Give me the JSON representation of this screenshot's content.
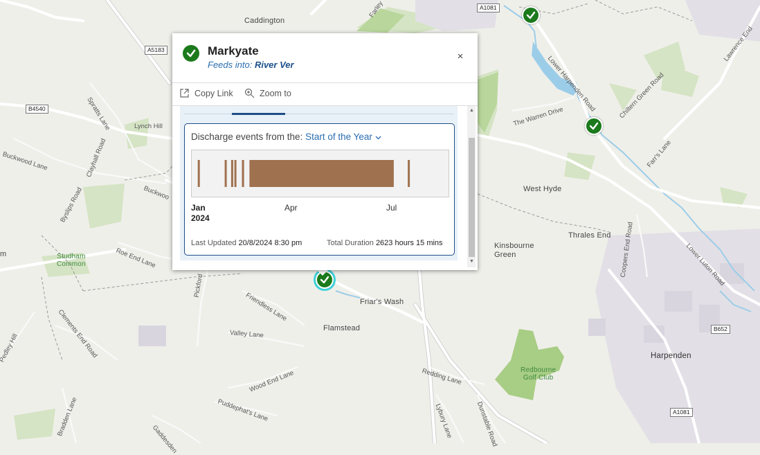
{
  "map": {
    "places": [
      {
        "id": "caddington",
        "label": "Caddington"
      },
      {
        "id": "west-hyde",
        "label": "West Hyde"
      },
      {
        "id": "thrales-end",
        "label": "Thrales End"
      },
      {
        "id": "kinsbourne-green",
        "label": "Kinsbourne\nGreen"
      },
      {
        "id": "friars-wash",
        "label": "Friar's Wash"
      },
      {
        "id": "flamstead",
        "label": "Flamstead"
      },
      {
        "id": "harpenden",
        "label": "Harpenden"
      },
      {
        "id": "studham-common",
        "label": "Studham\nCommon"
      },
      {
        "id": "redbourne-golf",
        "label": "Redbourne\nGolf Club"
      },
      {
        "id": "m-edge",
        "label": "m"
      }
    ],
    "roads": [
      {
        "id": "spratts-lane",
        "label": "Spratts Lane"
      },
      {
        "id": "lynch-hill",
        "label": "Lynch Hill"
      },
      {
        "id": "buckwood-lane",
        "label": "Buckwood Lane"
      },
      {
        "id": "clayhall-road",
        "label": "Clayhall Road"
      },
      {
        "id": "buckwood",
        "label": "Buckwoo"
      },
      {
        "id": "byslips-road",
        "label": "Byslips Road"
      },
      {
        "id": "roe-end-lane",
        "label": "Roe End Lane"
      },
      {
        "id": "pickford",
        "label": "Pickford"
      },
      {
        "id": "friendless-lane",
        "label": "Friendless Lane"
      },
      {
        "id": "valley-lane",
        "label": "Valley Lane"
      },
      {
        "id": "clements-end-road",
        "label": "Clements End Road"
      },
      {
        "id": "pedley-hill",
        "label": "Pedley Hill"
      },
      {
        "id": "wood-end-lane",
        "label": "Wood End Lane"
      },
      {
        "id": "puddephats-lane",
        "label": "Puddephat's Lane"
      },
      {
        "id": "bradden-lane",
        "label": "Bradden Lane"
      },
      {
        "id": "gaddesden",
        "label": "Gaddesden"
      },
      {
        "id": "redding-lane",
        "label": "Redding Lane"
      },
      {
        "id": "lybury-lane",
        "label": "Lybury Lane"
      },
      {
        "id": "dunstable-road",
        "label": "Dunstable Road"
      },
      {
        "id": "lower-harpenden-road",
        "label": "Lower Harpenden Road"
      },
      {
        "id": "the-warren-drive",
        "label": "The Warren Drive"
      },
      {
        "id": "chiltern-green-road",
        "label": "Chiltern Green Road"
      },
      {
        "id": "farrs-lane",
        "label": "Farr's Lane"
      },
      {
        "id": "lawrence-end",
        "label": "Lawrence End"
      },
      {
        "id": "coopers-end-road",
        "label": "Coopers End Road"
      },
      {
        "id": "lower-luton-road",
        "label": "Lower Luton Road"
      },
      {
        "id": "farley",
        "label": "Farley"
      }
    ],
    "shields": [
      {
        "id": "a5183",
        "label": "A5183"
      },
      {
        "id": "b4540",
        "label": "B4540"
      },
      {
        "id": "a1081-top",
        "label": "A1081"
      },
      {
        "id": "b652",
        "label": "B652"
      },
      {
        "id": "a1081-bottom",
        "label": "A1081"
      }
    ]
  },
  "popup": {
    "title": "Markyate",
    "feeds_prefix": "Feeds into:",
    "feeds_river": "River Ver",
    "close_glyph": "×",
    "copy_link": "Copy Link",
    "zoom_to": "Zoom to",
    "chart_heading": "Discharge events from the:",
    "period_select": "Start of the Year",
    "x_ticks": [
      {
        "label": "Jan",
        "sub": "2024",
        "bold": true
      },
      {
        "label": "Apr",
        "sub": "",
        "bold": false
      },
      {
        "label": "Jul",
        "sub": "",
        "bold": false
      }
    ],
    "last_updated_label": "Last Updated",
    "last_updated_value": "20/8/2024 8:30 pm",
    "total_duration_label": "Total Duration",
    "total_duration_value": "2623 hours 15 mins"
  },
  "chart_data": {
    "type": "timeline",
    "x_range": [
      "2024-01-01",
      "2024-08-20"
    ],
    "x_ticks": [
      "Jan 2024",
      "Apr",
      "Jul"
    ],
    "event_color": "#a0714f",
    "events": [
      {
        "start": "2024-01-04",
        "end": "2024-01-05"
      },
      {
        "start": "2024-01-29",
        "end": "2024-01-30"
      },
      {
        "start": "2024-02-04",
        "end": "2024-02-05"
      },
      {
        "start": "2024-02-07",
        "end": "2024-02-08"
      },
      {
        "start": "2024-02-14",
        "end": "2024-02-16"
      },
      {
        "start": "2024-02-21",
        "end": "2024-07-04"
      },
      {
        "start": "2024-07-17",
        "end": "2024-07-18"
      }
    ]
  },
  "colors": {
    "check_green": "#1b7a1b",
    "link_blue": "#2a6db0",
    "card_border": "#1f4e86",
    "selected_ring": "#3fd1d9"
  }
}
